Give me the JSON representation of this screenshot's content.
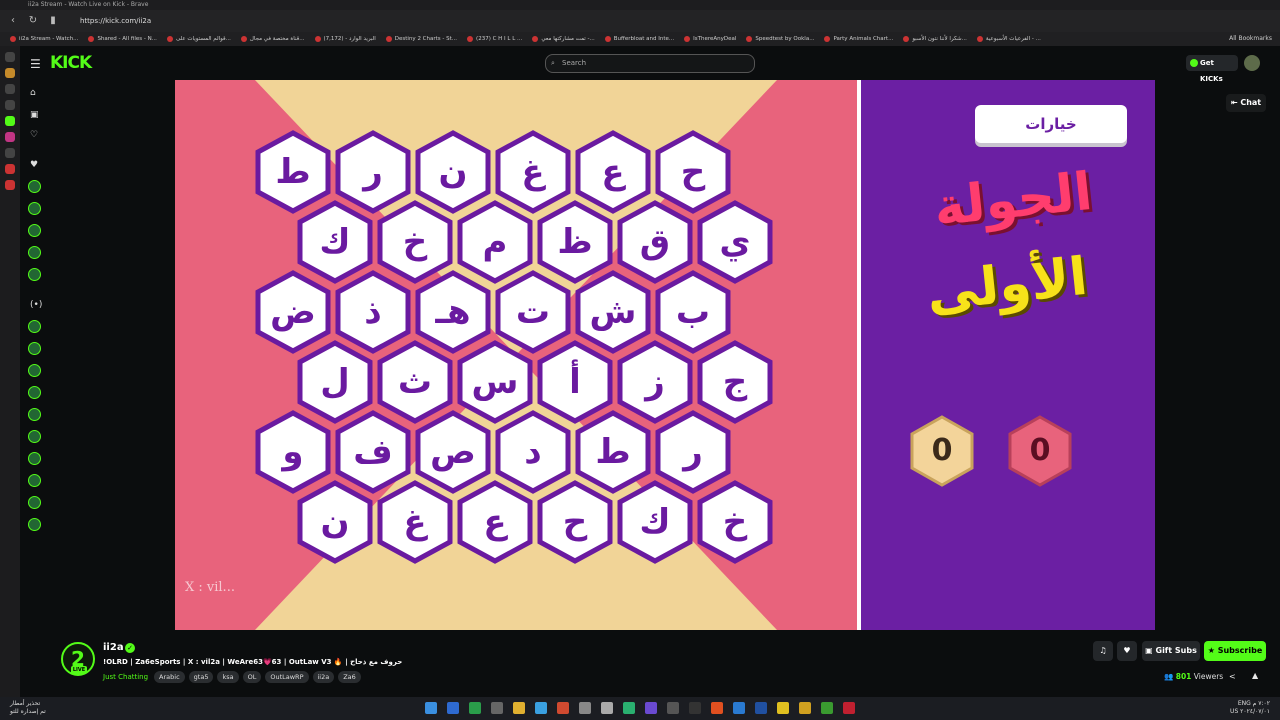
{
  "browser": {
    "tab_title": "ii2a Stream - Watch Live on Kick - Brave",
    "url": "https://kick.com/ii2a",
    "bookmarks": [
      "ii2a Stream - Watch...",
      "Shared - All files - N...",
      "قوالم المستويات على...",
      "قناة مختصة في مجال...",
      "البريد الوارد - (7,172)",
      "Destiny 2 Charts - St...",
      "(237) C H I L L ...",
      "تمت مشاركتها معي -...",
      "Bufferbloat and Inte...",
      "IsThereAnyDeal",
      "Speedtest by Ookla...",
      "Party Animals Chart...",
      "شكرا لأننا نتون الأسبو...",
      "الفرعيات الأسبوعية - ..."
    ],
    "all_bookmarks": "All Bookmarks"
  },
  "header": {
    "logo": "KICK",
    "search_placeholder": "Search",
    "get_kicks": "Get KICKs"
  },
  "game": {
    "rows": [
      [
        "ح",
        "ع",
        "غ",
        "ن",
        "ر",
        "ط"
      ],
      [
        "ي",
        "ق",
        "ظ",
        "م",
        "خ",
        "ك"
      ],
      [
        "ب",
        "ش",
        "ت",
        "هـ",
        "ذ",
        "ض"
      ],
      [
        "ج",
        "ز",
        "أ",
        "س",
        "ث",
        "ل"
      ],
      [
        "ر",
        "ط",
        "د",
        "ص",
        "ف",
        "و"
      ],
      [
        "خ",
        "ك",
        "ح",
        "ع",
        "غ",
        "ن"
      ]
    ],
    "options_button": "خيارات",
    "round_line1": "الجولة",
    "round_line2": "الأولى",
    "score_yellow": "0",
    "score_red": "0",
    "watermark": "X : vil..."
  },
  "chat_button": "Chat",
  "stream": {
    "channel": "ii2a",
    "avatar_letter": "2",
    "live_badge": "LIVE",
    "title": "!OLRD | Za6eSports | X : vil2a | WeAre63💗63 | OutLaw V3 🔥 | حروف مع ذحاح",
    "category": "Just Chatting",
    "tags": [
      "Arabic",
      "gta5",
      "ksa",
      "OL",
      "OutLawRP",
      "ii2a",
      "Za6"
    ],
    "viewers_count": "801",
    "viewers_label": "Viewers",
    "gift_subs": "Gift Subs",
    "subscribe": "Subscribe"
  },
  "taskbar": {
    "weather_line1": "تحذير أمطار",
    "weather_line2": "تم إصداره للتو",
    "lang": "ENG",
    "region": "US",
    "time": "٧:٠٢ م",
    "date": "٢٠٢٤/٠٧/٠١"
  },
  "colors": {
    "kick_green": "#53fc18",
    "board_purple": "#6a1aa0",
    "panel_purple": "#6b1fa3",
    "pink": "#e8637c",
    "sand": "#f1d497"
  }
}
